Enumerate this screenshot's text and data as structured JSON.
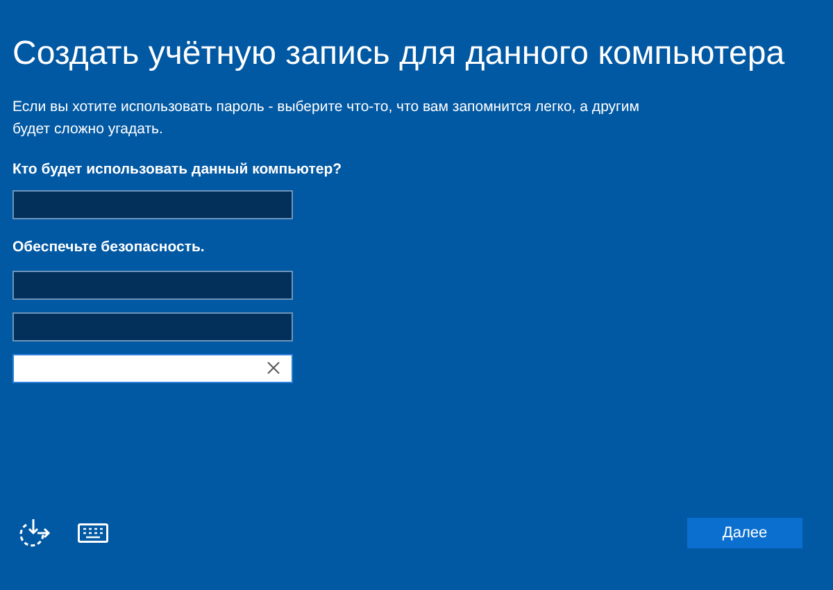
{
  "title": "Создать учётную запись для данного компьютера",
  "description": "Если вы хотите использовать пароль - выберите что-то, что вам запомнится легко, а другим будет сложно угадать.",
  "user_section": {
    "label": "Кто будет использовать данный компьютер?",
    "fields": [
      {
        "focused": false
      }
    ]
  },
  "security_section": {
    "label": "Обеспечьте безопасность.",
    "fields": [
      {
        "focused": false
      },
      {
        "focused": false
      },
      {
        "focused": true
      }
    ]
  },
  "next_button": "Далее"
}
